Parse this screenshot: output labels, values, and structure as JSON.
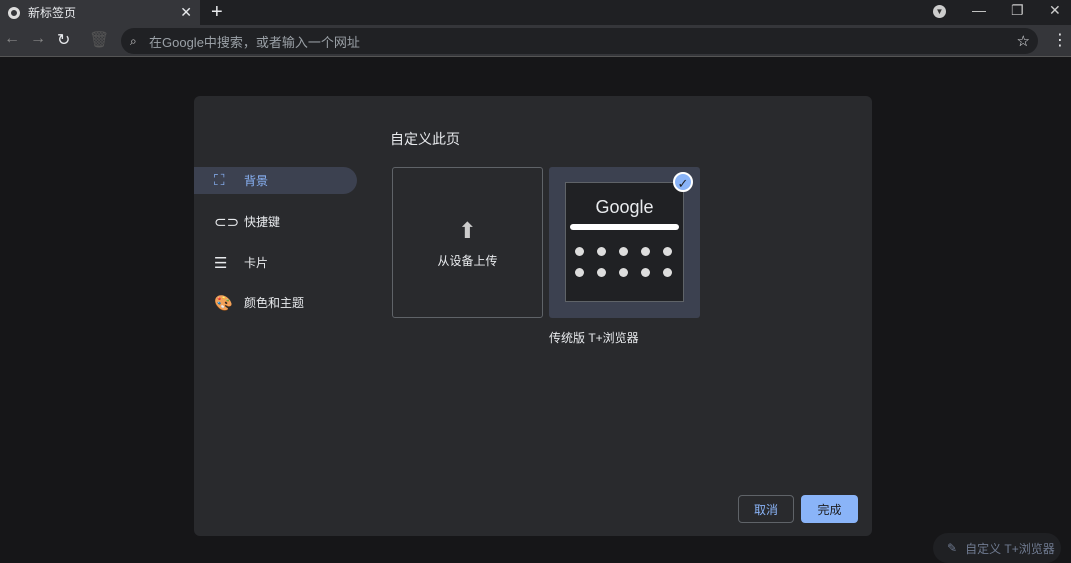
{
  "tab": {
    "title": "新标签页"
  },
  "omnibox": {
    "placeholder": "在Google中搜索，或者输入一个网址"
  },
  "dialog": {
    "title": "自定义此页",
    "sidebar": [
      {
        "label": "背景"
      },
      {
        "label": "快捷键"
      },
      {
        "label": "卡片"
      },
      {
        "label": "颜色和主题"
      }
    ],
    "upload_label": "从设备上传",
    "classic_logo": "Google",
    "classic_label": "传统版 T+浏览器",
    "cancel": "取消",
    "done": "完成"
  },
  "customize_button": "自定义 T+浏览器",
  "colors": {
    "accent": "#8ab4f8"
  }
}
